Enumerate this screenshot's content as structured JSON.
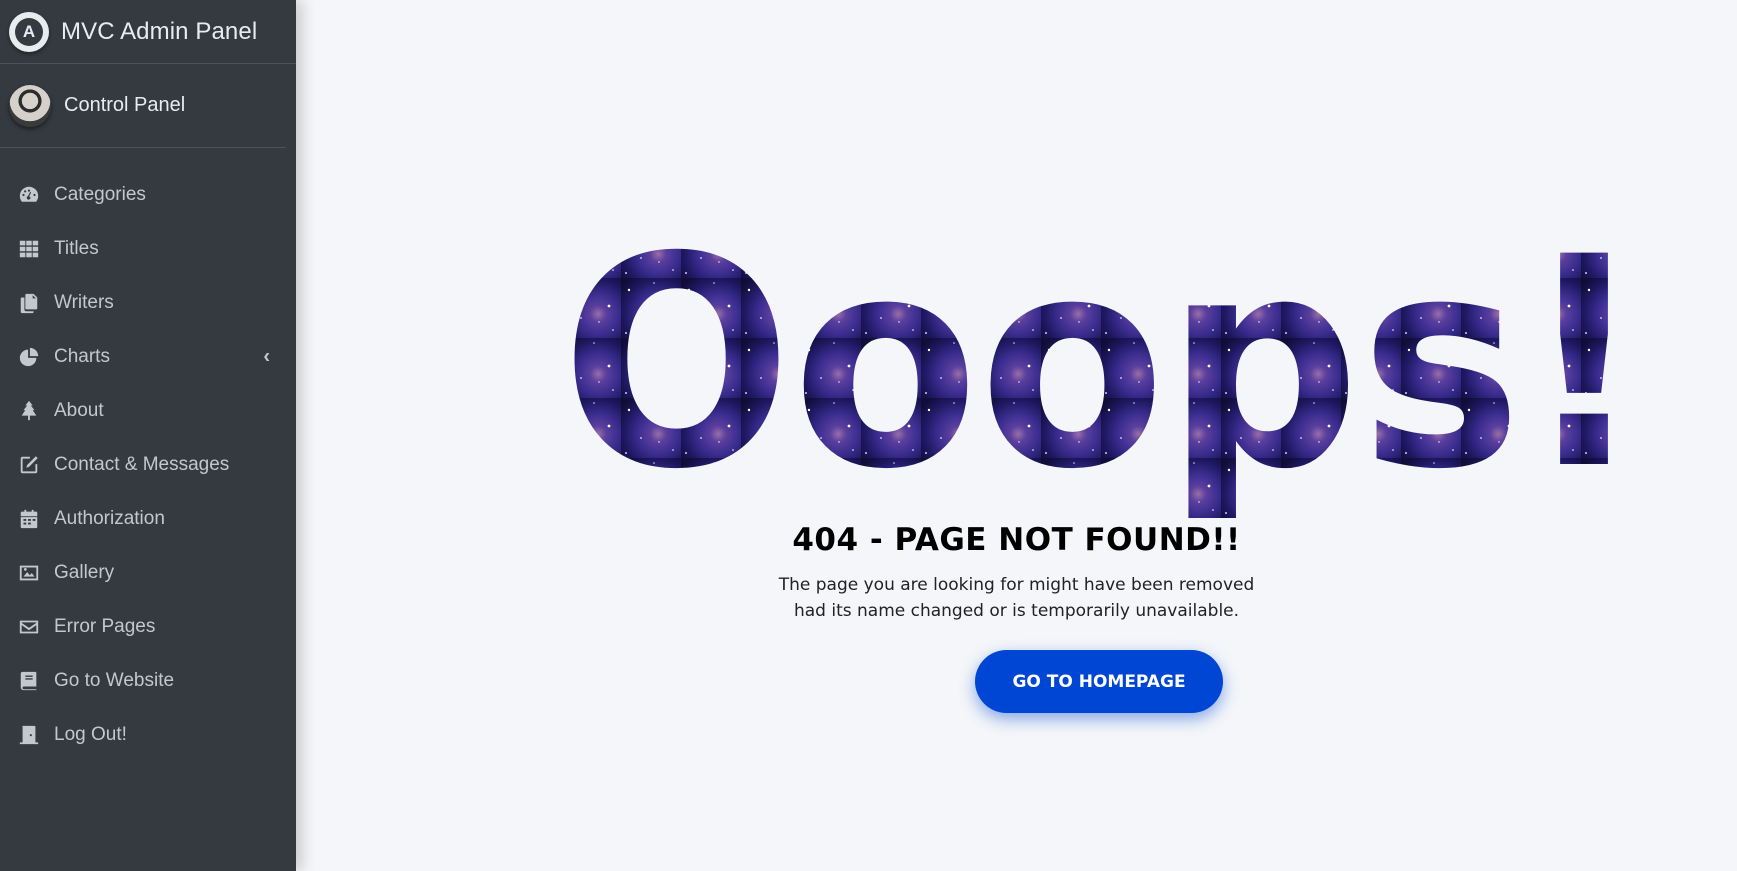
{
  "brand": {
    "title": "MVC Admin Panel",
    "logo_icon": "admin-logo-icon"
  },
  "user": {
    "name": "Control Panel",
    "avatar": "user-avatar"
  },
  "nav": [
    {
      "id": "categories",
      "label": "Categories",
      "icon": "dashboard-gauge-icon"
    },
    {
      "id": "titles",
      "label": "Titles",
      "icon": "grid-icon"
    },
    {
      "id": "writers",
      "label": "Writers",
      "icon": "copy-files-icon"
    },
    {
      "id": "charts",
      "label": "Charts",
      "icon": "pie-chart-icon",
      "has_submenu": true,
      "caret": "‹"
    },
    {
      "id": "about",
      "label": "About",
      "icon": "tree-icon"
    },
    {
      "id": "contact",
      "label": "Contact & Messages",
      "icon": "edit-icon"
    },
    {
      "id": "authorization",
      "label": "Authorization",
      "icon": "calendar-icon"
    },
    {
      "id": "gallery",
      "label": "Gallery",
      "icon": "image-icon"
    },
    {
      "id": "error-pages",
      "label": "Error Pages",
      "icon": "envelope-icon"
    },
    {
      "id": "website",
      "label": "Go to Website",
      "icon": "book-icon"
    },
    {
      "id": "logout",
      "label": "Log Out!",
      "icon": "door-icon"
    }
  ],
  "error": {
    "headline": "Ooops!",
    "title": "404 - PAGE NOT FOUND!!",
    "line1": "The page you are looking for might have been removed",
    "line2": "had its name changed or is temporarily unavailable.",
    "button": "GO TO HOMEPAGE"
  },
  "colors": {
    "sidebar_bg": "#343a40",
    "content_bg": "#f4f6f9",
    "button_bg": "#0046d5",
    "galaxy_dark": "#14103a",
    "galaxy_mid": "#3f2f8f"
  }
}
